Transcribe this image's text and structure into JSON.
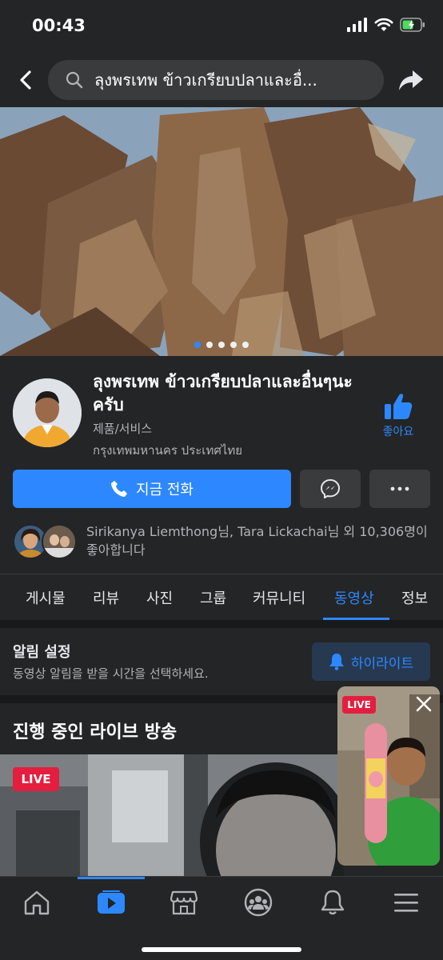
{
  "status_bar": {
    "time": "00:43"
  },
  "header": {
    "search_text": "ลุงพรเทพ ข้าวเกรียบปลาและอื่..."
  },
  "cover": {
    "slide_count": 5,
    "active_slide": 1
  },
  "page": {
    "name": "ลุงพรเทพ ข้าวเกรียบปลาและอื่นๆนะครับ",
    "category": "제품/서비스",
    "location": "กรุงเทพมหานคร ประเทศไทย",
    "like_label": "좋아요",
    "call_label": "지금 전화",
    "friends_text": "Sirikanya Liemthong님, Tara Lickachai님 외 10,306명이 좋아합니다"
  },
  "tabs": [
    {
      "label": "게시물"
    },
    {
      "label": "리뷰"
    },
    {
      "label": "사진"
    },
    {
      "label": "그룹"
    },
    {
      "label": "커뮤니티"
    },
    {
      "label": "동영상",
      "active": true
    },
    {
      "label": "정보"
    }
  ],
  "notifications": {
    "title": "알림 설정",
    "subtitle": "동영상 알림을 받을 시간을 선택하세요.",
    "highlight_label": "하이라이트"
  },
  "live": {
    "title": "진행 중인 라이브 방송",
    "badge": "LIVE",
    "pip_badge": "LIVE"
  },
  "colors": {
    "accent": "#2d88ff",
    "live_red": "#e41e3f",
    "surface": "#242526",
    "background": "#18191a"
  },
  "bottom_nav": [
    {
      "icon": "home-icon"
    },
    {
      "icon": "watch-icon",
      "active": true
    },
    {
      "icon": "marketplace-icon"
    },
    {
      "icon": "groups-icon"
    },
    {
      "icon": "bell-icon"
    },
    {
      "icon": "menu-icon"
    }
  ]
}
